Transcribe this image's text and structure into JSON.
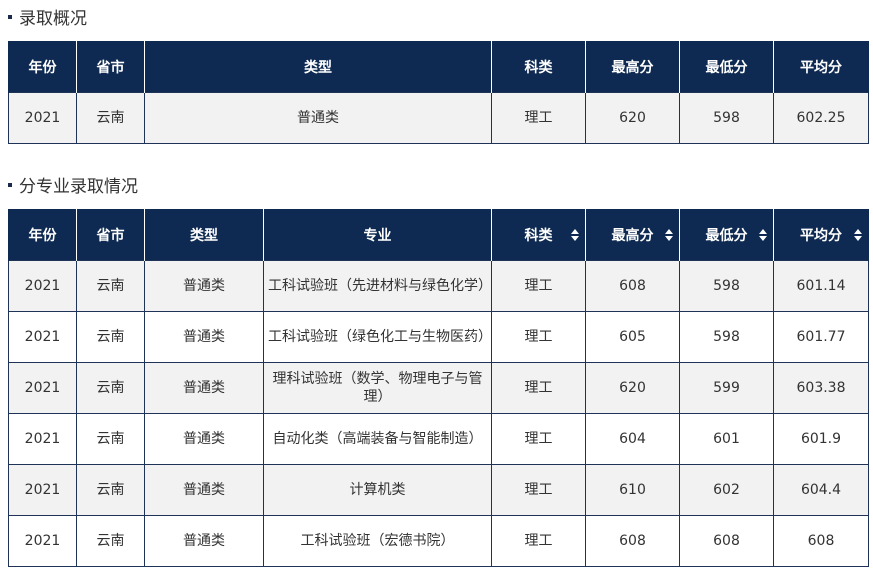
{
  "summary": {
    "title": "录取概况",
    "headers": [
      "年份",
      "省市",
      "类型",
      "科类",
      "最高分",
      "最低分",
      "平均分"
    ],
    "row": {
      "year": "2021",
      "province": "云南",
      "type": "普通类",
      "subject": "理工",
      "max": "620",
      "min": "598",
      "avg": "602.25"
    }
  },
  "majors": {
    "title": "分专业录取情况",
    "headers": [
      "年份",
      "省市",
      "类型",
      "专业",
      "科类",
      "最高分",
      "最低分",
      "平均分"
    ],
    "rows": [
      {
        "year": "2021",
        "province": "云南",
        "type": "普通类",
        "major": "工科试验班（先进材料与绿色化学）",
        "subject": "理工",
        "max": "608",
        "min": "598",
        "avg": "601.14"
      },
      {
        "year": "2021",
        "province": "云南",
        "type": "普通类",
        "major": "工科试验班（绿色化工与生物医药）",
        "subject": "理工",
        "max": "605",
        "min": "598",
        "avg": "601.77"
      },
      {
        "year": "2021",
        "province": "云南",
        "type": "普通类",
        "major": "理科试验班（数学、物理电子与管理）",
        "subject": "理工",
        "max": "620",
        "min": "599",
        "avg": "603.38"
      },
      {
        "year": "2021",
        "province": "云南",
        "type": "普通类",
        "major": "自动化类（高端装备与智能制造）",
        "subject": "理工",
        "max": "604",
        "min": "601",
        "avg": "601.9"
      },
      {
        "year": "2021",
        "province": "云南",
        "type": "普通类",
        "major": "计算机类",
        "subject": "理工",
        "max": "610",
        "min": "602",
        "avg": "604.4"
      },
      {
        "year": "2021",
        "province": "云南",
        "type": "普通类",
        "major": "工科试验班（宏德书院）",
        "subject": "理工",
        "max": "608",
        "min": "608",
        "avg": "608"
      }
    ]
  },
  "colors": {
    "header_bg": "#0f2a52",
    "row_grey": "#f2f2f2",
    "border": "#1f3358"
  }
}
